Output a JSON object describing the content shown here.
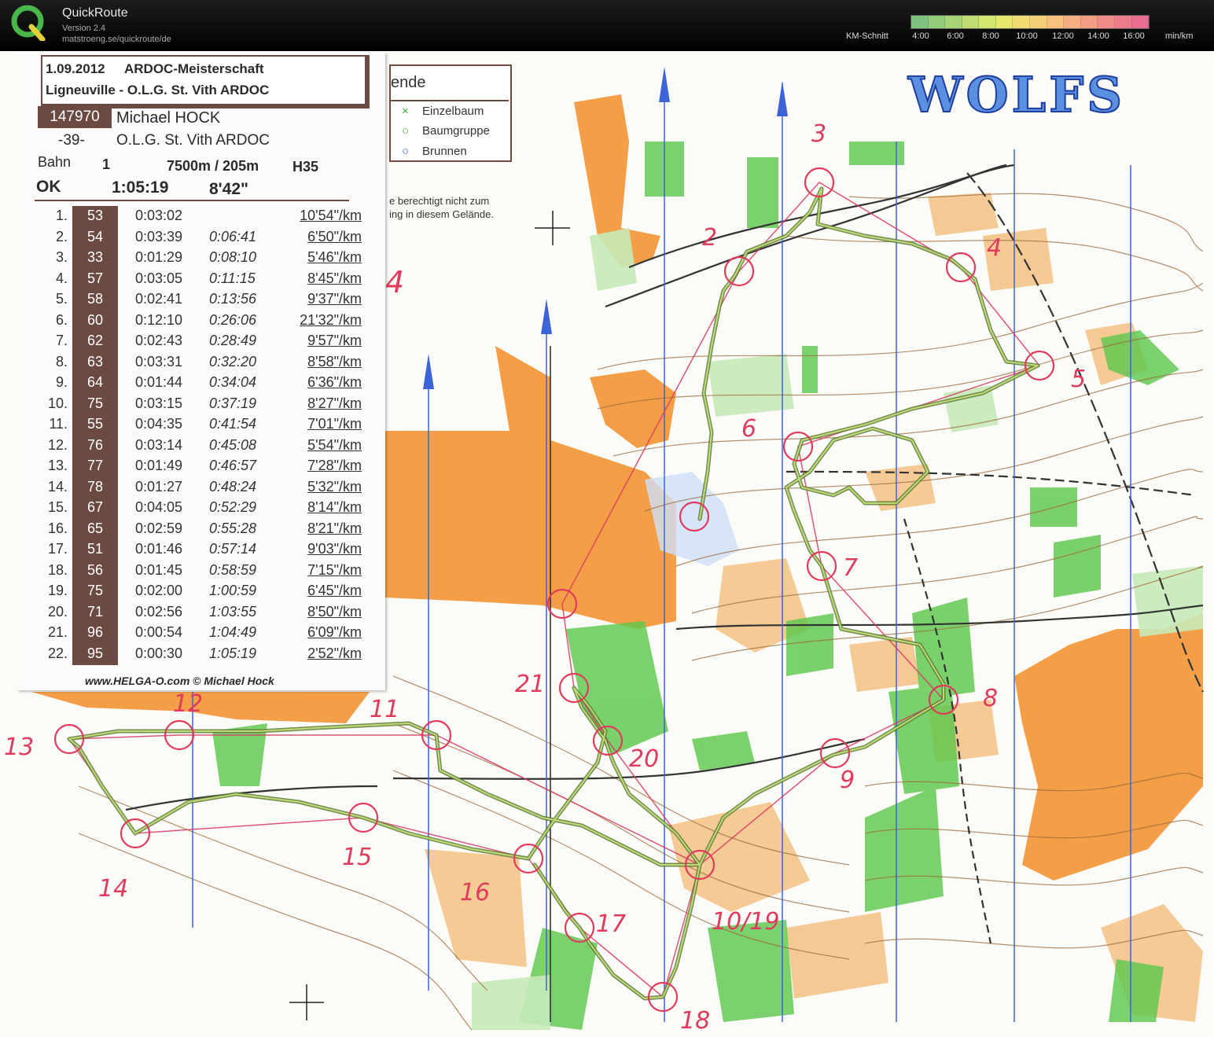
{
  "app": {
    "name": "QuickRoute",
    "version": "Version 2.4",
    "url": "matstroeng.se/quickroute/de"
  },
  "pace_scale": {
    "label": "KM-Schnitt",
    "ticks": [
      "4:00",
      "6:00",
      "8:00",
      "10:00",
      "12:00",
      "14:00",
      "16:00"
    ],
    "unit": "min/km",
    "colors": [
      "#7fc27f",
      "#93cc7a",
      "#a7d576",
      "#bddd72",
      "#d3e56f",
      "#e6e86d",
      "#f0dc72",
      "#f5cf78",
      "#f7c07c",
      "#f6ae80",
      "#f39d84",
      "#ef8c88",
      "#ec7c8c",
      "#e96e92"
    ]
  },
  "splits_card": {
    "event_date": "1.09.2012",
    "event_name": "ARDOC-Meisterschaft",
    "event_place": "Ligneuville - O.L.G. St. Vith ARDOC",
    "runner_id": "147970",
    "runner_name": "Michael HOCK",
    "runner_rank": "-39-",
    "runner_club": "O.L.G. St. Vith ARDOC",
    "course_label": "Bahn",
    "course_no": "1",
    "course_length": "7500m / 205m",
    "course_class": "H35",
    "status": "OK",
    "total_time": "1:05:19",
    "avg_pace": "8'42\"",
    "footer": "www.HELGA-O.com © Michael Hock",
    "splits": [
      {
        "n": "1.",
        "code": "53",
        "time": "0:03:02",
        "cum": "",
        "pace": "10'54\"/km"
      },
      {
        "n": "2.",
        "code": "54",
        "time": "0:03:39",
        "cum": "0:06:41",
        "pace": "6'50\"/km"
      },
      {
        "n": "3.",
        "code": "33",
        "time": "0:01:29",
        "cum": "0:08:10",
        "pace": "5'46\"/km"
      },
      {
        "n": "4.",
        "code": "57",
        "time": "0:03:05",
        "cum": "0:11:15",
        "pace": "8'45\"/km"
      },
      {
        "n": "5.",
        "code": "58",
        "time": "0:02:41",
        "cum": "0:13:56",
        "pace": "9'37\"/km"
      },
      {
        "n": "6.",
        "code": "60",
        "time": "0:12:10",
        "cum": "0:26:06",
        "pace": "21'32\"/km"
      },
      {
        "n": "7.",
        "code": "62",
        "time": "0:02:43",
        "cum": "0:28:49",
        "pace": "9'57\"/km"
      },
      {
        "n": "8.",
        "code": "63",
        "time": "0:03:31",
        "cum": "0:32:20",
        "pace": "8'58\"/km"
      },
      {
        "n": "9.",
        "code": "64",
        "time": "0:01:44",
        "cum": "0:34:04",
        "pace": "6'36\"/km"
      },
      {
        "n": "10.",
        "code": "75",
        "time": "0:03:15",
        "cum": "0:37:19",
        "pace": "8'27\"/km"
      },
      {
        "n": "11.",
        "code": "55",
        "time": "0:04:35",
        "cum": "0:41:54",
        "pace": "7'01\"/km"
      },
      {
        "n": "12.",
        "code": "76",
        "time": "0:03:14",
        "cum": "0:45:08",
        "pace": "5'54\"/km"
      },
      {
        "n": "13.",
        "code": "77",
        "time": "0:01:49",
        "cum": "0:46:57",
        "pace": "7'28\"/km"
      },
      {
        "n": "14.",
        "code": "78",
        "time": "0:01:27",
        "cum": "0:48:24",
        "pace": "5'32\"/km"
      },
      {
        "n": "15.",
        "code": "67",
        "time": "0:04:05",
        "cum": "0:52:29",
        "pace": "8'14\"/km"
      },
      {
        "n": "16.",
        "code": "65",
        "time": "0:02:59",
        "cum": "0:55:28",
        "pace": "8'21\"/km"
      },
      {
        "n": "17.",
        "code": "51",
        "time": "0:01:46",
        "cum": "0:57:14",
        "pace": "9'03\"/km"
      },
      {
        "n": "18.",
        "code": "56",
        "time": "0:01:45",
        "cum": "0:58:59",
        "pace": "7'15\"/km"
      },
      {
        "n": "19.",
        "code": "75",
        "time": "0:02:00",
        "cum": "1:00:59",
        "pace": "6'45\"/km"
      },
      {
        "n": "20.",
        "code": "71",
        "time": "0:02:56",
        "cum": "1:03:55",
        "pace": "8'50\"/km"
      },
      {
        "n": "21.",
        "code": "96",
        "time": "0:00:54",
        "cum": "1:04:49",
        "pace": "6'09\"/km"
      },
      {
        "n": "22.",
        "code": "95",
        "time": "0:00:30",
        "cum": "1:05:19",
        "pace": "2'52\"/km"
      }
    ]
  },
  "map_legend": {
    "title": "ende",
    "items": [
      {
        "symbol": "×",
        "color": "#3aa63a",
        "label": "Einzelbaum"
      },
      {
        "symbol": "○",
        "color": "#3aa63a",
        "label": "Baumgruppe"
      },
      {
        "symbol": "○",
        "color": "#2f5fd0",
        "label": "Brunnen"
      }
    ],
    "notice_line1": "e berechtigt nicht zum",
    "notice_line2": "ing in diesem Gelände."
  },
  "map_title": "WOLFS",
  "controls": [
    {
      "label": "2"
    },
    {
      "label": "3"
    },
    {
      "label": "4"
    },
    {
      "label": "5"
    },
    {
      "label": "6"
    },
    {
      "label": "7"
    },
    {
      "label": "8"
    },
    {
      "label": "9"
    },
    {
      "label": "10/19"
    },
    {
      "label": "11"
    },
    {
      "label": "12"
    },
    {
      "label": "13"
    },
    {
      "label": "14"
    },
    {
      "label": "15"
    },
    {
      "label": "16"
    },
    {
      "label": "17"
    },
    {
      "label": "18"
    },
    {
      "label": "20"
    },
    {
      "label": "21"
    },
    {
      "label": "4"
    }
  ]
}
